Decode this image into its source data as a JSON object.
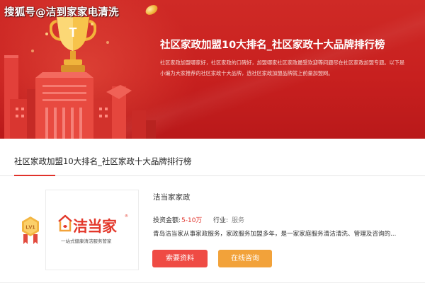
{
  "watermark": "搜狐号@洁到家家电清洗",
  "banner": {
    "title": "社区家政加盟10大排名_社区家政十大品牌排行榜",
    "description": "社区家政加盟哪家好，社区家政的口碑好，加盟哪家社区家政最受欢迎等问题尽在社区家政加盟专题。以下是小编为大家推荐的社区家政十大品牌，选社区家政加盟品牌就上前量加盟网。",
    "trophy_letter": "T"
  },
  "section": {
    "title": "社区家政加盟10大排名_社区家政十大品牌排行榜"
  },
  "card": {
    "badge": "LV1",
    "logo_text": "洁当家",
    "logo_subtitle": "一站式健康清洁服务管家",
    "logo_registered": "®",
    "brand_name": "洁当家家政",
    "invest_label": "投资金额:",
    "invest_value": "5-10万",
    "industry_label": "行业:",
    "industry_value": "服务",
    "description": "青岛洁当家从事家政服务，家政服务加盟多年，是一家家庭服务清洁清洗、管理及咨询的...",
    "buttons": {
      "request_info": "索要资料",
      "online_consult": "在线咨询"
    }
  },
  "colors": {
    "banner_red": "#c8201f",
    "accent_red": "#e0322a",
    "button_red": "#ef4b44",
    "button_orange": "#f2a23a",
    "gold": "#f1b43a"
  }
}
